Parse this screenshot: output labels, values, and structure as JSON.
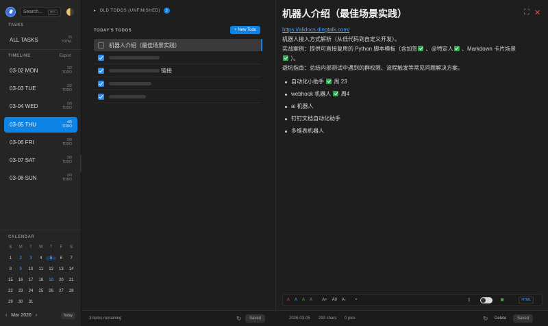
{
  "sidebar": {
    "search_placeholder": "Search...",
    "search_shortcut": "⌘K",
    "tasks_label": "TASKS",
    "all_tasks": {
      "label": "ALL TASKS",
      "count": "15",
      "count_unit": "TOTAL"
    },
    "timeline_label": "TIMELINE",
    "export_label": "Export",
    "days": [
      {
        "label": "03-02 MON",
        "count": "2/2",
        "unit": "TODO"
      },
      {
        "label": "03-03 TUE",
        "count": "2/2",
        "unit": "TODO"
      },
      {
        "label": "03-04 WED",
        "count": "0/0",
        "unit": "TODO"
      },
      {
        "label": "03-05 THU",
        "count": "4/5",
        "unit": "TODO"
      },
      {
        "label": "03-06 FRI",
        "count": "0/0",
        "unit": "TODO"
      },
      {
        "label": "03-07 SAT",
        "count": "0/0",
        "unit": "TODO"
      },
      {
        "label": "03-08 SUN",
        "count": "0/0",
        "unit": "TODO"
      }
    ],
    "calendar_label": "CALENDAR",
    "weekdays": [
      "S",
      "M",
      "T",
      "W",
      "T",
      "F",
      "S"
    ],
    "weeks": [
      [
        "1",
        "2",
        "3",
        "4",
        "5",
        "6",
        "7"
      ],
      [
        "8",
        "9",
        "10",
        "11",
        "12",
        "13",
        "14"
      ],
      [
        "15",
        "16",
        "17",
        "18",
        "19",
        "20",
        "21"
      ],
      [
        "22",
        "23",
        "24",
        "25",
        "26",
        "27",
        "28"
      ],
      [
        "29",
        "30",
        "31",
        "",
        "",
        "",
        ""
      ]
    ],
    "month": "Mar 2026",
    "today_btn": "Today"
  },
  "middle": {
    "old_todos_label": "OLD TODOS (UNFINISHED)",
    "old_todos_count": "3",
    "today_label": "TODAY'S TODOS",
    "new_todo_btn": "+ New Todo",
    "active_todo": "机器人介绍（最佳场景实践）",
    "todo_suffix": "链接",
    "remaining": "3 items remaining",
    "saved_btn": "Saved"
  },
  "editor": {
    "title": "机器人介绍（最佳场景实践）",
    "link": "https://alidocs.dingtalk.com/",
    "line1": "机器人接入方式解析（从低代码到自定义开发）。",
    "line2a": "实战案例：提供可直接复用的 Python 脚本模板（含加签",
    "line2b": "、@特定人",
    "line2c": "、Markdown 卡片场景",
    "line2d": "）。",
    "line3": "避坑指南：总结内部测试中遇到的群权限、流程触发等常见问题解决方案。",
    "bullets": {
      "b1a": "自动化小助手",
      "b1b": "周 23",
      "b2a": "webhook 机器人",
      "b2b": "周4",
      "b3": "ai 机器人",
      "b4": "钉钉文档自动化助手",
      "b5": "多维表机器人"
    },
    "toolbar": {
      "a": "A",
      "a_plus": "A+",
      "a_zero": "A0",
      "a_minus": "A-",
      "bullet": "•",
      "html": "HTML"
    },
    "footer": {
      "date": "2026-03-05",
      "chars": "293 chars",
      "pics": "0 pics",
      "delete": "Delete",
      "saved": "Saved"
    }
  },
  "colors": {
    "accent": "#0e83e6",
    "check": "#2fa84f",
    "close": "#e05050"
  }
}
